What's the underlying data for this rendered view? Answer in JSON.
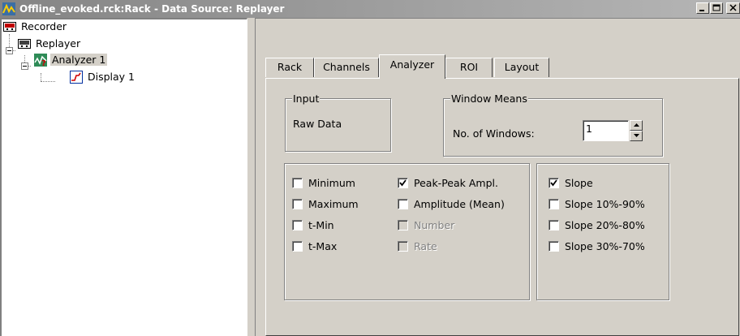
{
  "window": {
    "title": "Offline_evoked.rck:Rack - Data Source: Replayer",
    "buttons": [
      "minimize",
      "maximize",
      "close"
    ]
  },
  "tree": {
    "items": [
      {
        "label": "Recorder",
        "icon": "recorder-icon"
      },
      {
        "label": "Replayer",
        "icon": "replayer-icon"
      },
      {
        "label": "Analyzer 1",
        "icon": "analyzer-icon",
        "selected": true
      },
      {
        "label": "Display 1",
        "icon": "display-icon"
      }
    ]
  },
  "tabs": [
    {
      "label": "Rack"
    },
    {
      "label": "Channels"
    },
    {
      "label": "Analyzer",
      "active": true
    },
    {
      "label": "ROI"
    },
    {
      "label": "Layout"
    }
  ],
  "input_group": {
    "legend": "Input",
    "value": "Raw Data"
  },
  "window_means": {
    "legend": "Window Means",
    "label": "No. of Windows:",
    "value": "1"
  },
  "checks_left": [
    {
      "label": "Minimum",
      "checked": false,
      "disabled": false
    },
    {
      "label": "Maximum",
      "checked": false,
      "disabled": false
    },
    {
      "label": "t-Min",
      "checked": false,
      "disabled": false
    },
    {
      "label": "t-Max",
      "checked": false,
      "disabled": false
    }
  ],
  "checks_middle": [
    {
      "label": "Peak-Peak Ampl.",
      "checked": true,
      "disabled": false
    },
    {
      "label": "Amplitude (Mean)",
      "checked": false,
      "disabled": false
    },
    {
      "label": "Number",
      "checked": false,
      "disabled": true
    },
    {
      "label": "Rate",
      "checked": false,
      "disabled": true
    }
  ],
  "checks_right": [
    {
      "label": "Slope",
      "checked": true,
      "disabled": false
    },
    {
      "label": "Slope 10%-90%",
      "checked": false,
      "disabled": false
    },
    {
      "label": "Slope 20%-80%",
      "checked": false,
      "disabled": false
    },
    {
      "label": "Slope 30%-70%",
      "checked": false,
      "disabled": false
    }
  ],
  "colors": {
    "face": "#d4d0c8",
    "titlebar_start": "#848484",
    "titlebar_end": "#b6b6b6"
  }
}
